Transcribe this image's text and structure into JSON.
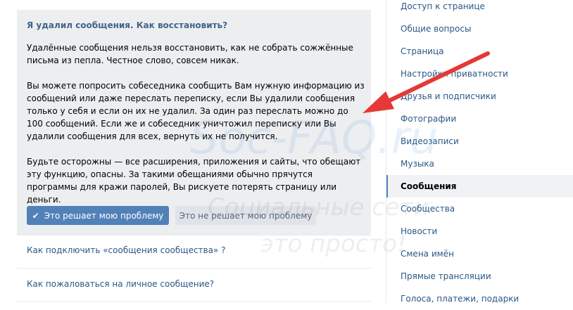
{
  "faq": {
    "title": "Я удалил сообщения. Как восстановить?",
    "paragraph1": "Удалённые сообщения нельзя восстановить, как не собрать сожжённые письма из пепла. Честное слово, совсем никак.",
    "paragraph2": "Вы можете попросить собеседника сообщить Вам нужную информацию из сообщений или даже переслать переписку, если Вы удалили сообщения только у себя и если он их не удалил. За один раз переслать можно до 100 сообщений. Если же и собеседник уничтожил переписку или Вы удалили сообщения для всех, вернуть их не получится.",
    "paragraph3": "Будьте осторожны — все расширения, приложения и сайты, что обещают эту функцию, опасны. За такими обещаниями обычно прячутся программы для кражи паролей, Вы рискуете потерять страницу или деньги.",
    "solved_label": "Это решает мою проблему",
    "not_solved_label": "Это не решает мою проблему"
  },
  "related": [
    "Как подключить «сообщения сообщества» ?",
    "Как пожаловаться на личное сообщение?"
  ],
  "sidebar": {
    "items": [
      "Доступ к странице",
      "Общие вопросы",
      "Страница",
      "Настройки приватности",
      "Друзья и подписчики",
      "Фотографии",
      "Видеозаписи",
      "Музыка",
      "Сообщения",
      "Сообщества",
      "Новости",
      "Смена имён",
      "Прямые трансляции",
      "Голоса, платежи, подарки"
    ],
    "active_index": 8
  },
  "watermark": {
    "logo": "Soc-FAQ.ru",
    "tagline1": "Социальные сети",
    "tagline2": "это просто!"
  },
  "colors": {
    "accent": "#5181b8",
    "link": "#2a5885",
    "title": "#42648b",
    "arrow": "#e53935"
  }
}
